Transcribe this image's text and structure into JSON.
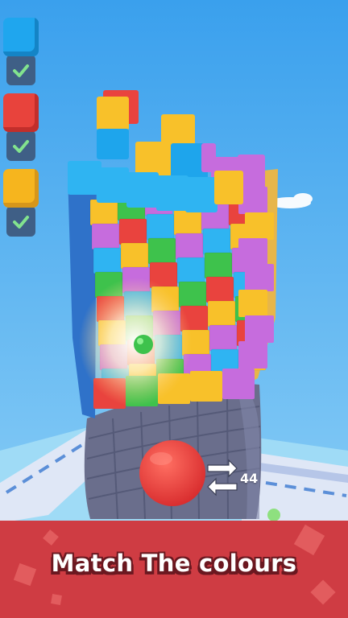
{
  "colors": {
    "sky_top": "#3fa3ee",
    "sky_bottom": "#8fd0f6",
    "swatch_blue": "#1fa6ee",
    "swatch_red": "#e8433c",
    "swatch_yellow": "#f6b51e",
    "check": "#7fe08a",
    "banner": "#cf3c43",
    "ball": "#e63a37",
    "tower_base": "#6b6f8f"
  },
  "color_targets": [
    {
      "name": "blue",
      "completed": true
    },
    {
      "name": "red",
      "completed": true
    },
    {
      "name": "yellow",
      "completed": true
    }
  ],
  "ammo": {
    "count": "44"
  },
  "banner": {
    "text": "Match The colours"
  }
}
